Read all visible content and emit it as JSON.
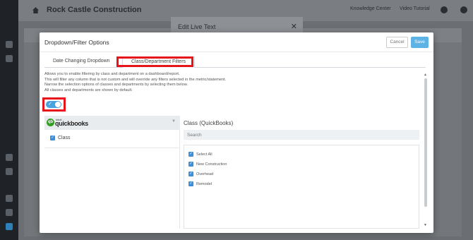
{
  "app": {
    "company": "Rock Castle Construction",
    "header_links": [
      "Knowledge Center",
      "Video Tutorial"
    ]
  },
  "back_dialog": {
    "title": "Edit Live Text"
  },
  "modal": {
    "title": "Dropdown/Filter Options",
    "cancel_label": "Cancel",
    "save_label": "Save",
    "tabs": [
      {
        "label": "Date Changing Dropdown",
        "active": false
      },
      {
        "label": "Class/Department Filters",
        "active": true
      }
    ],
    "description": [
      "Allows you to enable filtering by class and department on a dashboard/report.",
      "This will filter any column that is not custom and will override any filters selected in the metric/statement.",
      "Narrow the selection options of classes and departments by selecting them below.",
      "All classes and departments are shown by default."
    ],
    "toggle_enabled": true,
    "integration": {
      "logo_small": "intuit",
      "name": "quickbooks",
      "items": [
        {
          "label": "Class",
          "checked": true
        }
      ]
    },
    "class_panel": {
      "title": "Class (QuickBooks)",
      "search_placeholder": "Search",
      "options": [
        {
          "label": "Select All",
          "checked": true
        },
        {
          "label": "New Construction",
          "checked": true
        },
        {
          "label": "Overhead",
          "checked": true
        },
        {
          "label": "Remodel",
          "checked": true
        }
      ]
    }
  },
  "colors": {
    "accent": "#5eb3e6",
    "checkbox": "#3d8fd8",
    "highlight": "#e8141b",
    "quickbooks_green": "#2ca01c"
  }
}
